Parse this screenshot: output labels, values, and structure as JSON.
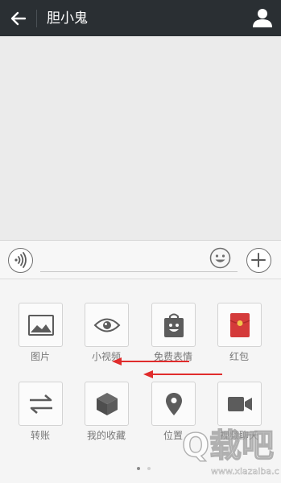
{
  "header": {
    "title": "胆小鬼"
  },
  "input": {
    "placeholder": ""
  },
  "panel": {
    "items": [
      {
        "label": "图片",
        "icon": "image-icon"
      },
      {
        "label": "小视频",
        "icon": "eye-icon"
      },
      {
        "label": "免费表情",
        "icon": "emoji-bag-icon"
      },
      {
        "label": "红包",
        "icon": "red-packet-icon"
      },
      {
        "label": "转账",
        "icon": "transfer-icon"
      },
      {
        "label": "我的收藏",
        "icon": "cube-icon"
      },
      {
        "label": "位置",
        "icon": "location-icon"
      },
      {
        "label": "视频聊天",
        "icon": "video-camera-icon"
      }
    ],
    "page_count": 2,
    "current_page": 1
  },
  "watermark": {
    "text": "Q载吧",
    "sub": "www.xiazaiba.com"
  },
  "colors": {
    "topbar": "#2a2f33",
    "accent_red": "#e02c2c",
    "red_packet": "#d43a3a",
    "icon_gray": "#5c5c5c"
  }
}
